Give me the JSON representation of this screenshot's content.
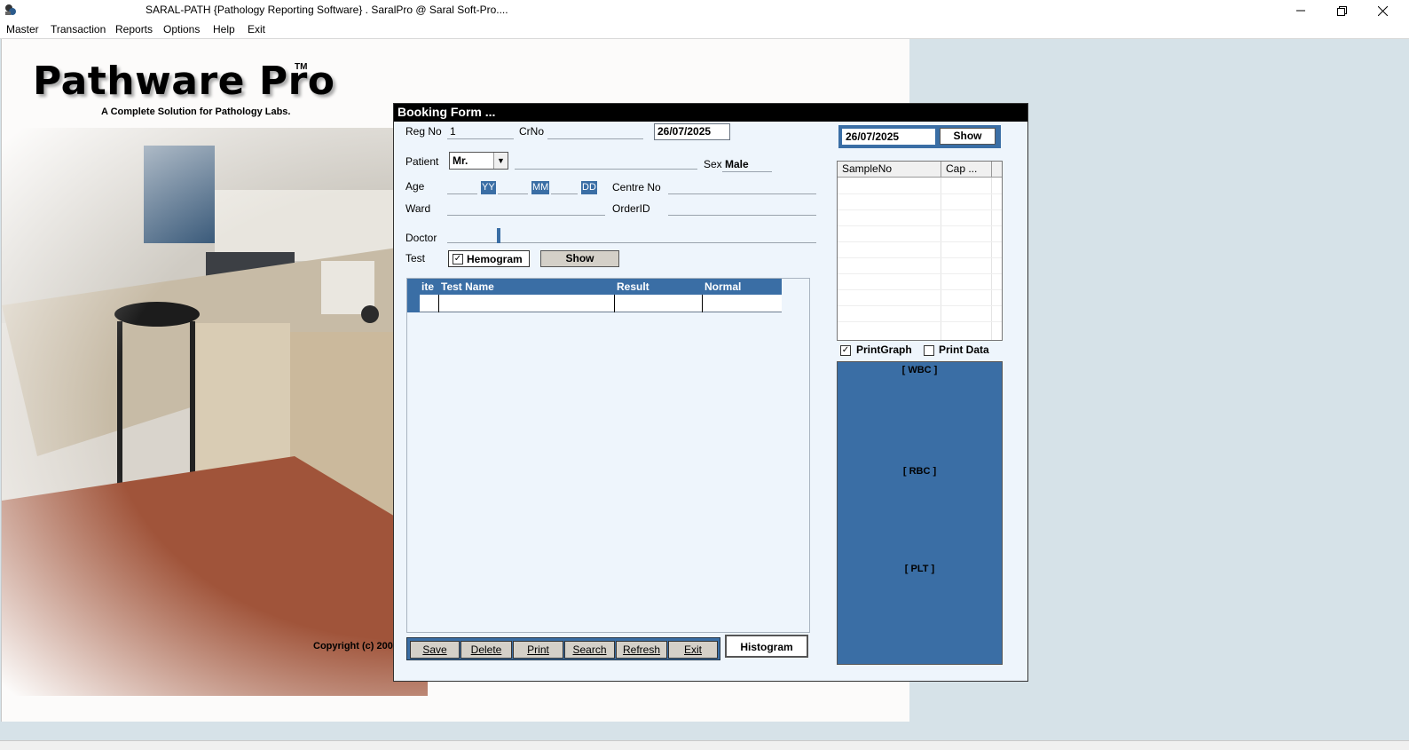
{
  "window": {
    "title": "SARAL-PATH {Pathology Reporting Software} .  SaralPro @ Saral Soft-Pro....",
    "minimize_icon": "minimize-icon",
    "restore_icon": "restore-icon",
    "close_icon": "close-icon"
  },
  "menu": [
    "Master",
    "Transaction",
    "Reports",
    "Options",
    "Help",
    "Exit"
  ],
  "splash": {
    "title": "Pathware Pro",
    "tm": "TM",
    "subtitle": "A Complete Solution for Pathology Labs.",
    "copyright": "Copyright (c) 200"
  },
  "form": {
    "title": "Booking Form ...",
    "reg_no_label": "Reg No",
    "reg_no_value": "1",
    "crno_label": "CrNo",
    "date_value": "26/07/2025",
    "patient_label": "Patient",
    "patient_title": "Mr.",
    "sex_label": "Sex",
    "sex_value": "Male",
    "age_label": "Age",
    "age_yy": "YY",
    "age_mm": "MM",
    "age_dd": "DD",
    "centre_no_label": "Centre No",
    "ward_label": "Ward",
    "order_id_label": "OrderID",
    "doctor_label": "Doctor",
    "test_label": "Test",
    "test_checkbox": "Hemogram",
    "test_checked": true,
    "show_label": "Show",
    "grid": {
      "columns": [
        "ite",
        "Test Name",
        "Result",
        "Normal"
      ]
    },
    "toolbar": [
      "Save",
      "Delete",
      "Print",
      "Search",
      "Refresh",
      "Exit"
    ],
    "histogram_label": "Histogram",
    "right": {
      "date_value": "26/07/2025",
      "show_label": "Show",
      "list_columns": [
        "SampleNo",
        "Cap ..."
      ],
      "print_graph_label": "PrintGraph",
      "print_graph_checked": true,
      "print_data_label": "Print Data",
      "print_data_checked": false,
      "graph_labels": [
        "[ WBC ]",
        "[ RBC ]",
        "[ PLT ]"
      ]
    }
  },
  "colors": {
    "accent_blue": "#3a6ea5",
    "form_bg": "#eef5fc",
    "mdi_bg": "#d6e2e8"
  }
}
